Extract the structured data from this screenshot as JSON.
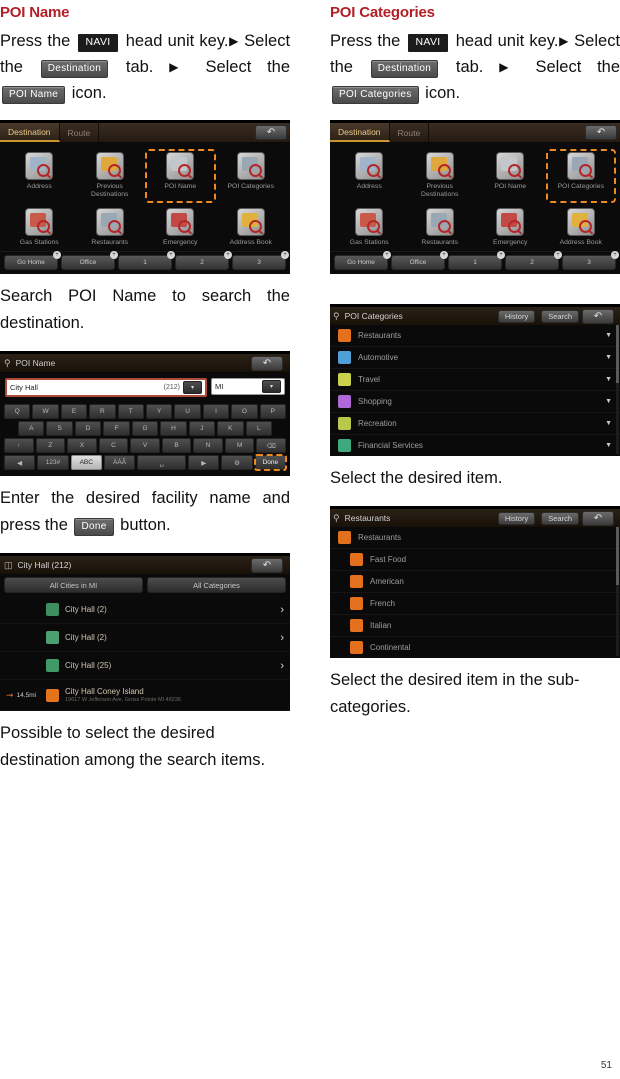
{
  "page": {
    "number": "51"
  },
  "left": {
    "title": "POI Name",
    "intro": {
      "p1": "Press the",
      "key": "NAVI",
      "p2": "head unit key.",
      "arrow1": "▶",
      "p3": "Select the",
      "tab": "Destination",
      "p4": "tab.",
      "arrow2": "▶",
      "p5": "Select the",
      "icon": "POI Name",
      "p6": "icon."
    },
    "caption1": "Search POI Name to search the destination.",
    "caption2_a": "Enter the desired facility name and press the",
    "caption2_key": "Done",
    "caption2_b": "button.",
    "caption3": "Possible to select the desired destination among the search items.",
    "shot_destination": {
      "tabs": [
        "Destination",
        "Route"
      ],
      "back_icon": "back-arrow-icon",
      "grid": [
        {
          "label": "Address",
          "selected": false,
          "color": "#9fb4c9"
        },
        {
          "label": "Previous Destinations",
          "selected": false,
          "color": "#e0a83c"
        },
        {
          "label": "POI Name",
          "selected": true,
          "color": "#c2c7cc"
        },
        {
          "label": "POI Categories",
          "selected": false,
          "color": "#9aa7b5"
        },
        {
          "label": "Gas Stations",
          "selected": false,
          "color": "#c85a4a"
        },
        {
          "label": "Restaurants",
          "selected": false,
          "color": "#9aa7b5"
        },
        {
          "label": "Emergency",
          "selected": false,
          "color": "#c24a46"
        },
        {
          "label": "Address Book",
          "selected": false,
          "color": "#e0b13c"
        }
      ],
      "footer": [
        "Go Home",
        "Office",
        "1",
        "2",
        "3"
      ],
      "footer_badge": "+"
    },
    "shot_keyboard": {
      "search_icon": "magnifier-icon",
      "title": "POI Name",
      "back_icon": "back-arrow-icon",
      "input_value": "City Hall",
      "input_count": "(212)",
      "state_value": "MI",
      "dropdown_icon": "chevron-down-icon",
      "rows": [
        [
          "Q",
          "W",
          "E",
          "R",
          "T",
          "Y",
          "U",
          "I",
          "O",
          "P"
        ],
        [
          "A",
          "S",
          "D",
          "F",
          "G",
          "H",
          "J",
          "K",
          "L"
        ],
        [
          "↑",
          "Z",
          "X",
          "C",
          "V",
          "B",
          "N",
          "M",
          "⌫"
        ],
        [
          "◀",
          "123#",
          "ABC",
          "ÀÁÂ",
          "␣",
          "▶",
          "⚙",
          "Done"
        ]
      ],
      "lit_key": "ABC",
      "done_key": "Done"
    },
    "shot_results": {
      "list_icon": "list-icon",
      "title": "City Hall (212)",
      "back_icon": "back-arrow-icon",
      "tabs": [
        "All Cities in MI",
        "All Categories"
      ],
      "rows": [
        {
          "name": "City Hall (2)",
          "sub": "",
          "dist": "",
          "color": "#3d8f5e",
          "chevron": "›"
        },
        {
          "name": "City Hall (2)",
          "sub": "",
          "dist": "",
          "color": "#4aa070",
          "chevron": "›"
        },
        {
          "name": "City Hall (25)",
          "sub": "",
          "dist": "",
          "color": "#3f9a68",
          "chevron": "›"
        },
        {
          "name": "City Hall Coney Island",
          "sub": "19617 W Jefferson Ave, Gross Pointe MI 48236",
          "dist": "14.5mi",
          "color": "#e4741c",
          "chevron": ""
        }
      ]
    }
  },
  "right": {
    "title": "POI Categories",
    "intro": {
      "p1": "Press the",
      "key": "NAVI",
      "p2": "head unit key.",
      "arrow1": "▶",
      "p3": "Select the",
      "tab": "Destination",
      "p4": "tab.",
      "arrow2": "▶",
      "p5": "Select the",
      "icon": "POI Categories",
      "p6": "icon."
    },
    "caption1": "Select the desired item.",
    "caption2": "Select the desired item in the sub-categories.",
    "shot_destination": {
      "tabs": [
        "Destination",
        "Route"
      ],
      "back_icon": "back-arrow-icon",
      "grid": [
        {
          "label": "Address",
          "selected": false,
          "color": "#9fb4c9"
        },
        {
          "label": "Previous Destinations",
          "selected": false,
          "color": "#e0a83c"
        },
        {
          "label": "POI Name",
          "selected": false,
          "color": "#c2c7cc"
        },
        {
          "label": "POI Categories",
          "selected": true,
          "color": "#9aa7b5"
        },
        {
          "label": "Gas Stations",
          "selected": false,
          "color": "#c85a4a"
        },
        {
          "label": "Restaurants",
          "selected": false,
          "color": "#9aa7b5"
        },
        {
          "label": "Emergency",
          "selected": false,
          "color": "#c24a46"
        },
        {
          "label": "Address Book",
          "selected": false,
          "color": "#e0b13c"
        }
      ],
      "footer": [
        "Go Home",
        "Office",
        "1",
        "2",
        "3"
      ],
      "footer_badge": "+"
    },
    "shot_categories": {
      "icon": "category-search-icon",
      "title": "POI Categories",
      "buttons": [
        "History",
        "Search"
      ],
      "back_icon": "back-arrow-icon",
      "caret_icon": "caret-down-icon",
      "rows": [
        {
          "name": "Restaurants",
          "color": "#e2701c"
        },
        {
          "name": "Automotive",
          "color": "#4f9fd8"
        },
        {
          "name": "Travel",
          "color": "#c9d24a"
        },
        {
          "name": "Shopping",
          "color": "#b068d8"
        },
        {
          "name": "Recreation",
          "color": "#b8c84a"
        },
        {
          "name": "Financial Services",
          "color": "#3fa87e"
        }
      ]
    },
    "shot_subcategories": {
      "icon": "category-search-icon",
      "title": "Restaurants",
      "buttons": [
        "History",
        "Search"
      ],
      "back_icon": "back-arrow-icon",
      "rows": [
        {
          "name": "Restaurants",
          "color": "#e2701c",
          "level": 0
        },
        {
          "name": "Fast Food",
          "color": "#e2701c",
          "level": 1
        },
        {
          "name": "American",
          "color": "#e2701c",
          "level": 1
        },
        {
          "name": "French",
          "color": "#e2701c",
          "level": 1
        },
        {
          "name": "Italian",
          "color": "#e2701c",
          "level": 1
        },
        {
          "name": "Continental",
          "color": "#e2701c",
          "level": 1
        }
      ]
    }
  }
}
